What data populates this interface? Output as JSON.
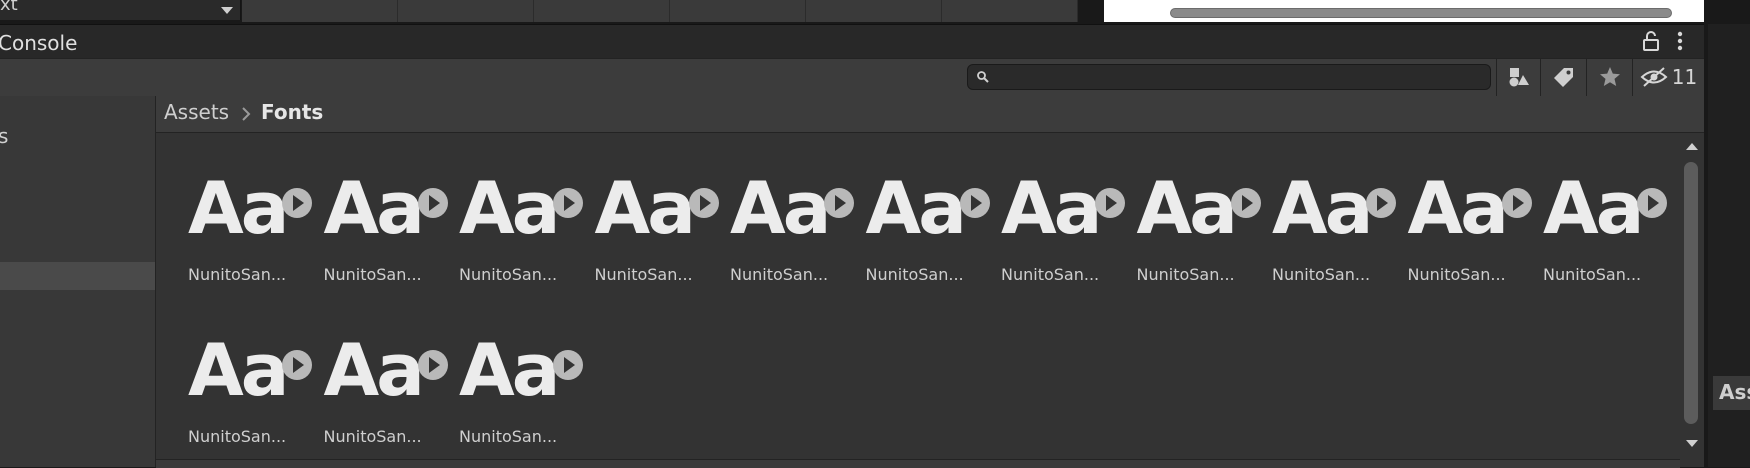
{
  "top": {
    "dropdown_text": "xt"
  },
  "tab": {
    "console_label": "Console"
  },
  "toolbar": {
    "search_value": "",
    "search_placeholder": "",
    "hidden_count": "11"
  },
  "left_panel": {
    "item_label": "s"
  },
  "breadcrumb": {
    "root": "Assets",
    "current": "Fonts"
  },
  "assets": [
    {
      "glyph": "Aa",
      "label": "NunitoSan..."
    },
    {
      "glyph": "Aa",
      "label": "NunitoSan..."
    },
    {
      "glyph": "Aa",
      "label": "NunitoSan..."
    },
    {
      "glyph": "Aa",
      "label": "NunitoSan..."
    },
    {
      "glyph": "Aa",
      "label": "NunitoSan..."
    },
    {
      "glyph": "Aa",
      "label": "NunitoSan..."
    },
    {
      "glyph": "Aa",
      "label": "NunitoSan..."
    },
    {
      "glyph": "Aa",
      "label": "NunitoSan..."
    },
    {
      "glyph": "Aa",
      "label": "NunitoSan..."
    },
    {
      "glyph": "Aa",
      "label": "NunitoSan..."
    },
    {
      "glyph": "Aa",
      "label": "NunitoSan..."
    },
    {
      "glyph": "Aa",
      "label": "NunitoSan..."
    },
    {
      "glyph": "Aa",
      "label": "NunitoSan..."
    },
    {
      "glyph": "Aa",
      "label": "NunitoSan..."
    }
  ],
  "right_panel": {
    "tab_label": "Ass"
  },
  "icons": {
    "play": "play-icon",
    "lock": "lock-open-icon",
    "menu": "kebab-menu-icon",
    "search": "search-icon",
    "filter_type": "filter-by-type-icon",
    "filter_label": "filter-by-label-icon",
    "favorites": "favorites-star-icon",
    "hidden": "hidden-eye-icon"
  },
  "colors": {
    "background": "#191919",
    "panel": "#333333",
    "toolbar": "#3c3c3c",
    "text": "#cfcfcf",
    "glyph": "#ececec"
  }
}
